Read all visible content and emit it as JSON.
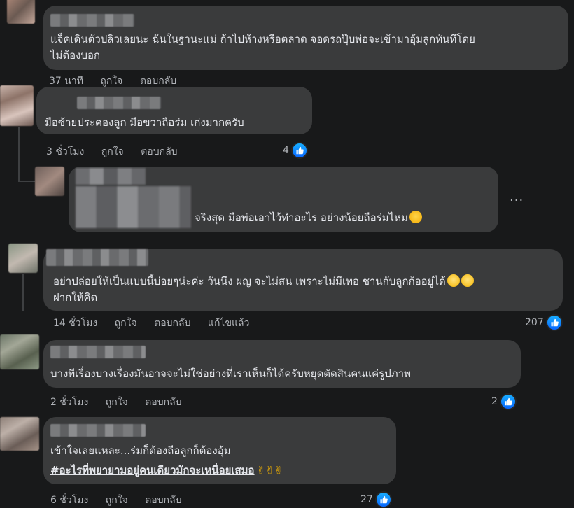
{
  "colors": {
    "background": "#18191a",
    "bubble": "#3a3b3c",
    "text": "#e4e6eb",
    "meta": "#b0b3b8",
    "like": "#0866ff"
  },
  "comments": [
    {
      "text_line1": "แจ็คเดินตัวปลิวเลยนะ ฉันในฐานะแม่ ถ้าไปห้างหรือตลาด จอดรถปุ๊บพ่อจะเข้ามาอุ้มลูกทันทีโดย",
      "text_line2": "ไม่ต้องบอก",
      "time": "37 นาที",
      "like": "ถูกใจ",
      "reply": "ตอบกลับ"
    },
    {
      "text_line1": "มือซ้ายประคองลูก มือขวาถือร่ม เก่งมากครับ",
      "time": "3 ชั่วโมง",
      "like": "ถูกใจ",
      "reply": "ตอบกลับ",
      "reactions": "4"
    },
    {
      "text_line1": "จริงสุด มือพ่อเอาไว้ทำอะไร อย่างน้อยถือร่มไหม",
      "more": "···",
      "emoji": "sweat-smile-emoji"
    },
    {
      "text_line1": "อย่าปล่อยให้เป็นแบบนี้บ่อยๆน่ะค่ะ วันนึง ผญ จะไม่สน เพราะไม่มีเทอ ชานกับลูกก้ออยู่ได้",
      "text_line2": "ฝากให้คิด",
      "time": "14 ชั่วโมง",
      "like": "ถูกใจ",
      "reply": "ตอบกลับ",
      "edited": "แก้ไขแล้ว",
      "reactions": "207",
      "emoji": "crying-emoji"
    },
    {
      "text_line1": "บางทีเรื่องบางเรื่องมันอาจจะไม่ใช่อย่างที่เราเห็นก็ได้ครับหยุดตัดสินคนแค่รูปภาพ",
      "time": "2 ชั่วโมง",
      "like": "ถูกใจ",
      "reply": "ตอบกลับ",
      "reactions": "2"
    },
    {
      "text_line1": "เข้าใจเลยแหละ...ร่มก็ต้องถือลูกก็ต้องอุ้ม",
      "text_line2": "#อะไรที่พยายามอยู่คนเดียวมักจะเหนื่อยเสมอ",
      "hands": "✌✌✌",
      "time": "6 ชั่วโมง",
      "like": "ถูกใจ",
      "reply": "ตอบกลับ",
      "reactions": "27"
    }
  ]
}
